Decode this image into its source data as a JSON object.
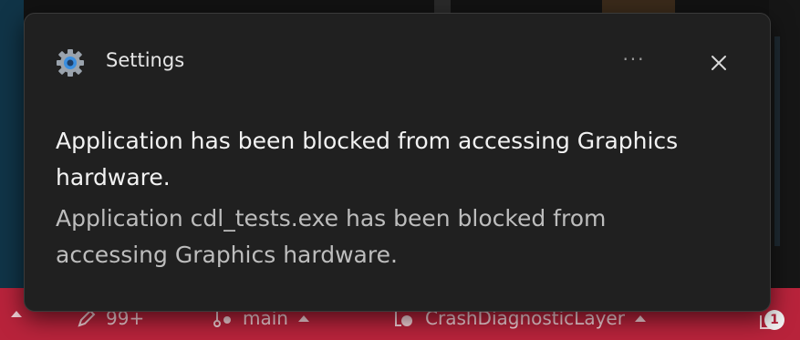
{
  "notification": {
    "app_name": "Settings",
    "app_icon": "gear-icon",
    "more_label": "···",
    "title": "Application has been blocked from accessing Graphics hardware.",
    "body": "Application cdl_tests.exe has been blocked from accessing Graphics hardware."
  },
  "statusbar": {
    "errors": "99+",
    "branch": "main",
    "project": "CrashDiagnosticLayer",
    "notification_count": "1"
  },
  "colors": {
    "statusbar_bg": "#b8233b",
    "toast_bg": "#202020",
    "gear_accent": "#3b8fe0"
  }
}
